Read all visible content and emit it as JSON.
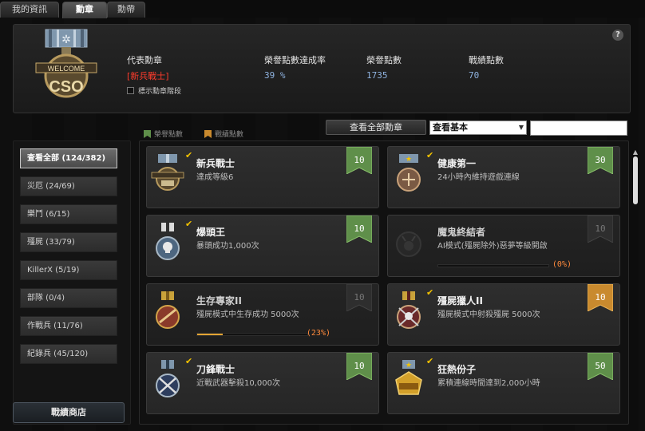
{
  "tabs": [
    {
      "label": "我的資訊",
      "active": false
    },
    {
      "label": "勳章",
      "active": true
    },
    {
      "label": "勳帶",
      "active": false
    }
  ],
  "header": {
    "main_medal_text": "WELCOME",
    "main_medal_logo": "CSO",
    "representative_label": "代表勳章",
    "representative_value": "[新兵戰士]",
    "show_stage_label": "標示勳章階段",
    "completion_label": "榮譽點數達成率",
    "completion_value": "39 %",
    "honor_label": "榮譽點數",
    "honor_value": "1735",
    "record_label": "戰績點數",
    "record_value": "70",
    "help_icon": "?"
  },
  "legend": {
    "honor_points": "榮譽點數",
    "record_points": "戰績點數"
  },
  "toolbar": {
    "view_all_label": "查看全部勳章",
    "filter_selected": "查看基本",
    "search_value": ""
  },
  "sidebar": {
    "items": [
      {
        "label": "查看全部 (124/382)",
        "active": true
      },
      {
        "label": "災厄 (24/69)",
        "active": false
      },
      {
        "label": "樂鬥 (6/15)",
        "active": false
      },
      {
        "label": "殭屍 (33/79)",
        "active": false
      },
      {
        "label": "KillerX (5/19)",
        "active": false
      },
      {
        "label": "部隊 (0/4)",
        "active": false
      },
      {
        "label": "作戰兵 (11/76)",
        "active": false
      },
      {
        "label": "紀錄兵 (45/120)",
        "active": false
      }
    ],
    "shop_label": "戰績商店"
  },
  "cards": [
    {
      "title": "新兵戰士",
      "desc": "達成等級6",
      "points": "10",
      "ribbon": "green",
      "completed": true,
      "icon": "welcome-medal-icon",
      "progress": null,
      "progress_label": ""
    },
    {
      "title": "健康第一",
      "desc": "24小時內維持遊戲連線",
      "points": "30",
      "ribbon": "green",
      "completed": true,
      "icon": "star-medal-icon",
      "progress": null,
      "progress_label": ""
    },
    {
      "title": "爆頭王",
      "desc": "暴頭成功1,000次",
      "points": "10",
      "ribbon": "green",
      "completed": true,
      "icon": "skull-medal-icon",
      "progress": null,
      "progress_label": ""
    },
    {
      "title": "魔鬼終結者",
      "desc": "AI模式(殭屍除外)惡夢等級開啟",
      "points": "10",
      "ribbon": "gray",
      "completed": false,
      "icon": "demon-medal-icon",
      "progress": 0,
      "progress_label": "(0%)"
    },
    {
      "title": "生存專家II",
      "desc": "殭屍模式中生存成功 5000次",
      "points": "10",
      "ribbon": "gray",
      "completed": false,
      "icon": "survival-medal-icon",
      "progress": 23,
      "progress_label": "(23%)"
    },
    {
      "title": "殭屍獵人II",
      "desc": "殭屍模式中射殺殭屍 5000次",
      "points": "10",
      "ribbon": "orange",
      "completed": true,
      "icon": "zombie-hunter-medal-icon",
      "progress": null,
      "progress_label": ""
    },
    {
      "title": "刀鋒戰士",
      "desc": "近戰武器擊殺10,000次",
      "points": "10",
      "ribbon": "green",
      "completed": true,
      "icon": "blade-medal-icon",
      "progress": null,
      "progress_label": ""
    },
    {
      "title": "狂熱份子",
      "desc": "累積連線時間達到2,000小時",
      "points": "50",
      "ribbon": "green",
      "completed": true,
      "icon": "gold-cso-medal-icon",
      "progress": null,
      "progress_label": ""
    }
  ],
  "colors": {
    "ribbon_green": "#5f8f4a",
    "ribbon_gray": "#3a3a3a",
    "ribbon_orange": "#c98a2e",
    "check": "#f2c200",
    "representative": "#ff3b2b",
    "stat_value": "#8fb3e0"
  }
}
